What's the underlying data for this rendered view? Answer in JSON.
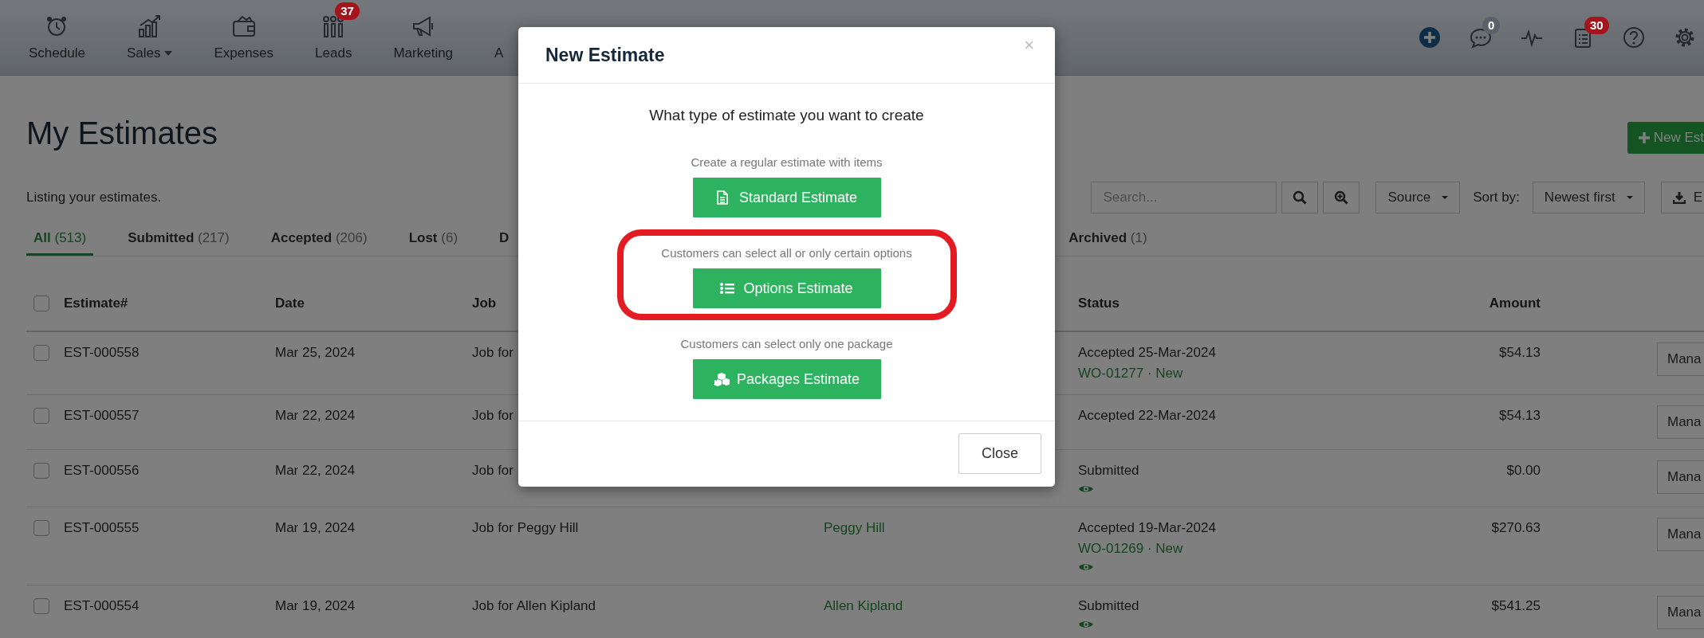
{
  "navbar": {
    "items": [
      {
        "label": "Schedule",
        "dropdown": false
      },
      {
        "label": "Sales",
        "dropdown": true
      },
      {
        "label": "Expenses",
        "dropdown": false
      },
      {
        "label": "Leads",
        "dropdown": false,
        "badge": {
          "text": "37",
          "color": "#a3141d"
        }
      },
      {
        "label": "Marketing",
        "dropdown": false
      },
      {
        "label": "A",
        "dropdown": false
      }
    ],
    "icon_badges": [
      {
        "text": "0",
        "color": "#5b6168"
      },
      {
        "text": "30",
        "color": "#a3141d"
      }
    ]
  },
  "page": {
    "title": "My Estimates",
    "new_button": "New Est",
    "subtitle": "Listing your estimates."
  },
  "toolbar": {
    "search_placeholder": "Search...",
    "source": "Source",
    "sort_label": "Sort by:",
    "sort_value": "Newest first",
    "export": "E"
  },
  "tabs": [
    {
      "label": "All",
      "count": "(513)",
      "selected": true
    },
    {
      "label": "Submitted",
      "count": "(217)",
      "selected": false
    },
    {
      "label": "Accepted",
      "count": "(206)",
      "selected": false
    },
    {
      "label": "Lost",
      "count": "(6)",
      "selected": false
    },
    {
      "label": "D",
      "selected": false
    },
    {
      "label": "Archived",
      "count": "(1)",
      "selected": false
    }
  ],
  "table": {
    "select_all_checked": false,
    "columns": [
      "Estimate#",
      "Date",
      "Job",
      "Status",
      "Amount"
    ],
    "rows": [
      {
        "checked": false,
        "estimate": "EST-000558",
        "date": "Mar 25, 2024",
        "job": "Job for",
        "status": "Accepted 25-Mar-2024",
        "work_order": "WO-01277 · New",
        "viewed": false,
        "amount": "$54.13",
        "action": "Mana"
      },
      {
        "checked": false,
        "estimate": "EST-000557",
        "date": "Mar 22, 2024",
        "job": "Job for",
        "status": "Accepted 22-Mar-2024",
        "viewed": false,
        "amount": "$54.13",
        "action": "Mana"
      },
      {
        "checked": false,
        "estimate": "EST-000556",
        "date": "Mar 22, 2024",
        "job": "Job for",
        "status": "Submitted",
        "viewed": true,
        "amount": "$0.00",
        "action": "Mana"
      },
      {
        "checked": false,
        "estimate": "EST-000555",
        "date": "Mar 19, 2024",
        "job": "Job for Peggy Hill",
        "customer": "Peggy Hill",
        "status": "Accepted 19-Mar-2024",
        "work_order": "WO-01269 · New",
        "viewed": true,
        "amount": "$270.63",
        "action": "Mana"
      },
      {
        "checked": false,
        "estimate": "EST-000554",
        "date": "Mar 19, 2024",
        "job": "Job for Allen Kipland",
        "customer": "Allen Kipland",
        "status": "Submitted",
        "viewed": true,
        "amount": "$541.25",
        "action": "Mana"
      }
    ]
  },
  "modal": {
    "title": "New Estimate",
    "close": "×",
    "question": "What type of estimate you want to create",
    "options": [
      {
        "description": "Create a regular estimate with items",
        "button": "Standard Estimate",
        "highlighted": false
      },
      {
        "description": "Customers can select all or only certain options",
        "button": "Options Estimate",
        "highlighted": true
      },
      {
        "description": "Customers can select only one package",
        "button": "Packages Estimate",
        "highlighted": false
      }
    ],
    "footer_button": "Close"
  }
}
